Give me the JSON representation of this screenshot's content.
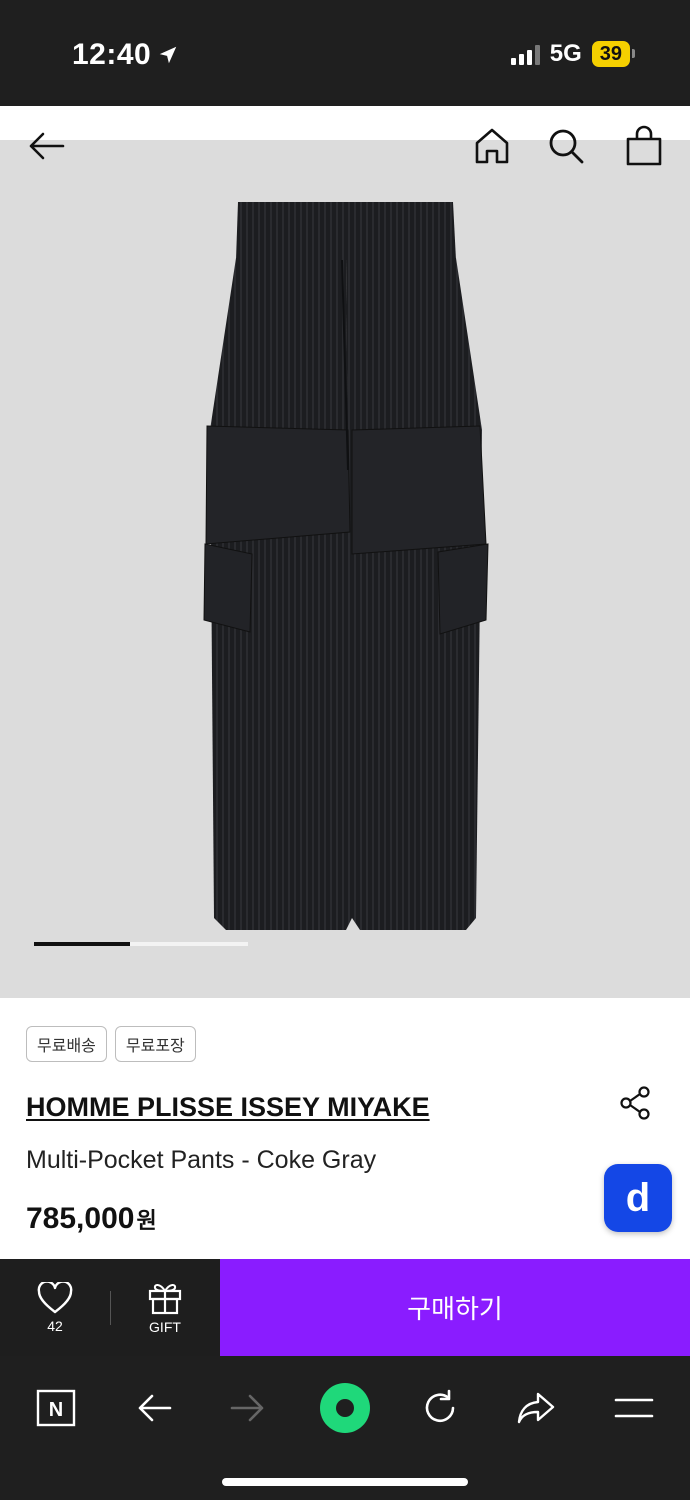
{
  "status_bar": {
    "time": "12:40",
    "network": "5G",
    "battery": "39"
  },
  "hero": {
    "image_alt": "black pleated multi-pocket pants",
    "carousel_progress": 0.45
  },
  "product": {
    "tags": [
      "무료배송",
      "무료포장"
    ],
    "brand": "HOMME PLISSE ISSEY MIYAKE",
    "name": "Multi-Pocket Pants - Coke Gray",
    "price": "785,000",
    "price_unit": "원"
  },
  "floating_button": {
    "label": "d"
  },
  "buy_bar": {
    "like_count": "42",
    "gift_label": "GIFT",
    "buy_label": "구매하기"
  },
  "browser_bar": {
    "logo": "N"
  },
  "colors": {
    "buy_button": "#8a1cff",
    "float_button": "#1447e6",
    "battery": "#f5d000",
    "record_button": "#1fd87a"
  }
}
